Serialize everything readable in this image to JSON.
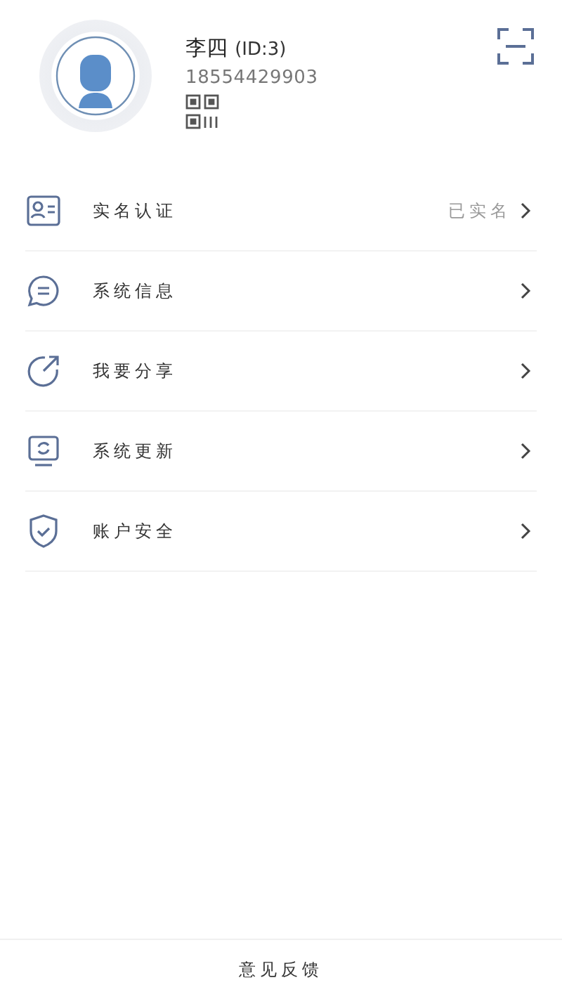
{
  "profile": {
    "name": "李四",
    "id": "(ID:3)",
    "phone": "18554429903"
  },
  "menu": [
    {
      "kind": "id-card",
      "label": "实名认证",
      "status": "已实名"
    },
    {
      "kind": "message",
      "label": "系统信息"
    },
    {
      "kind": "share",
      "label": "我要分享"
    },
    {
      "kind": "update",
      "label": "系统更新"
    },
    {
      "kind": "shield",
      "label": "账户安全"
    }
  ],
  "footer": {
    "label": "意见反馈"
  }
}
